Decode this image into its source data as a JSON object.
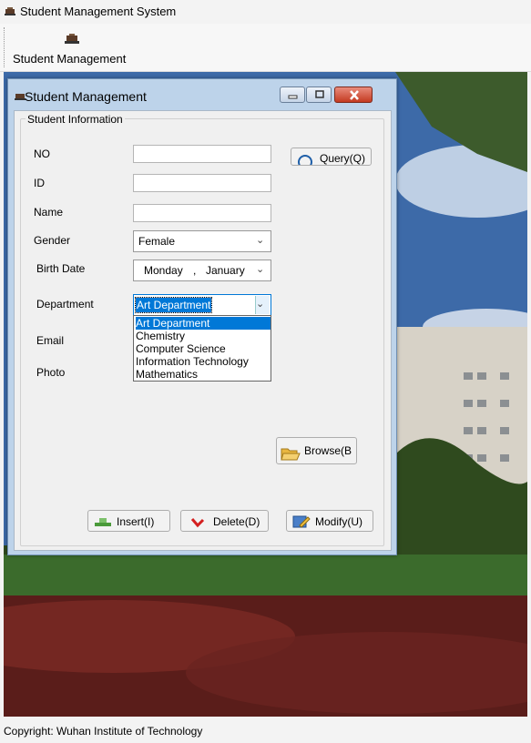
{
  "app": {
    "title": "Student Management System"
  },
  "menu": {
    "item_label": "Student Management"
  },
  "status": {
    "copyright": "Copyright: Wuhan Institute of Technology"
  },
  "child_window": {
    "title": "Student Management",
    "group_label": "Student Information",
    "fields": {
      "no_label": "NO",
      "id_label": "ID",
      "name_label": "Name",
      "gender_label": "Gender",
      "birth_label": "Birth Date",
      "department_label": "Department",
      "email_label": "Email",
      "photo_label": "Photo"
    },
    "values": {
      "no": "",
      "id": "",
      "name": "",
      "gender": "Female",
      "birth_day": "Monday",
      "birth_sep": ",",
      "birth_month": "January",
      "department": "Art Department"
    },
    "department_options": [
      "Art Department",
      "Chemistry",
      "Computer Science",
      "Information Technology",
      "Mathematics"
    ],
    "buttons": {
      "query": "Query(Q)",
      "browse": "Browse(B",
      "insert": "Insert(I)",
      "delete": "Delete(D)",
      "modify": "Modify(U)"
    }
  },
  "colors": {
    "selection": "#0078d7",
    "window_frame": "#bdd3ea",
    "close_button": "#c43a21"
  }
}
